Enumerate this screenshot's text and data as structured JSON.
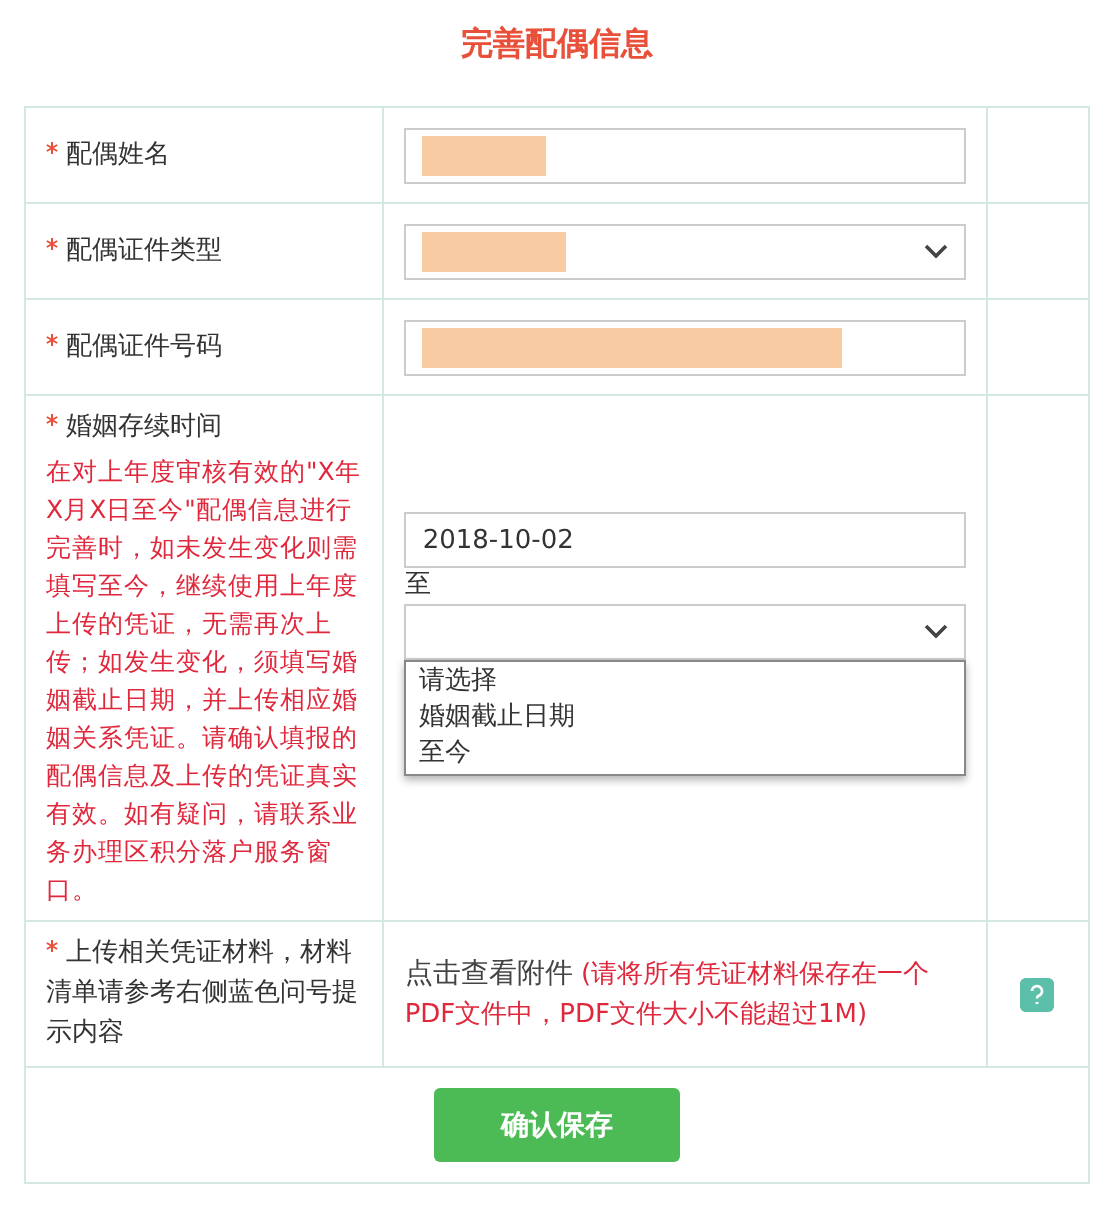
{
  "title": "完善配偶信息",
  "rows": [
    {
      "kind": "text",
      "label": "配偶姓名",
      "required": true,
      "redacted": true
    },
    {
      "kind": "select",
      "label": "配偶证件类型",
      "required": true,
      "redacted": true
    },
    {
      "kind": "text",
      "label": "配偶证件号码",
      "required": true,
      "redacted": true
    },
    {
      "kind": "date_range",
      "label": "婚姻存续时间",
      "required": true,
      "note": "在对上年度审核有效的\"X年X月X日至今\"配偶信息进行完善时，如未发生变化则需填写至今，继续使用上年度上传的凭证，无需再次上传；如发生变化，须填写婚姻截止日期，并上传相应婚姻关系凭证。请确认填报的配偶信息及上传的凭证真实有效。如有疑问，请联系业务办理区积分落户服务窗口。",
      "start_value": "2018-10-02",
      "separator": "至",
      "end_select": {
        "expanded": true,
        "options": [
          "请选择",
          "婚姻截止日期",
          "至今"
        ]
      }
    },
    {
      "kind": "upload",
      "label": "上传相关凭证材料，材料清单请参考右侧蓝色问号提示内容",
      "required": true,
      "link": "点击查看附件",
      "note": "(请将所有凭证材料保存在一个PDF文件中，PDF文件大小不能超过1M)",
      "help": true
    }
  ],
  "button": "确认保存"
}
